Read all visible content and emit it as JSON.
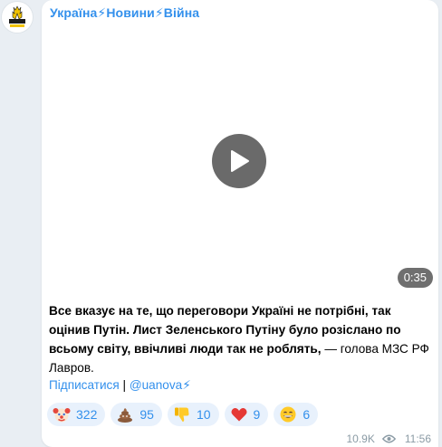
{
  "channel": {
    "name": "Україна⚡Новини⚡Війна",
    "avatar_text": "НОВИНИ"
  },
  "video": {
    "duration": "0:35"
  },
  "post": {
    "text_bold": "Все вказує на те, що переговори Україні не потрібні, так оцінив Путін. Лист Зеленського Путіну було розіслано по всьому світу, ввічливі люди так не роблять,",
    "text_regular": " — голова МЗС РФ Лавров."
  },
  "links": {
    "subscribe": "Підписатися",
    "separator": " | ",
    "handle": "@uanova⚡"
  },
  "reactions": [
    {
      "icon": "clown-face-icon",
      "count": "322"
    },
    {
      "icon": "pile-of-poo-icon",
      "count": "95"
    },
    {
      "icon": "thumbs-down-icon",
      "count": "10"
    },
    {
      "icon": "red-heart-icon",
      "count": "9"
    },
    {
      "icon": "grinning-face-icon",
      "count": "6"
    }
  ],
  "meta": {
    "views": "10.9K",
    "time": "11:56"
  },
  "colors": {
    "accent": "#3390ec",
    "background": "#e9eef3",
    "reaction_bg": "#e8f1fc"
  }
}
